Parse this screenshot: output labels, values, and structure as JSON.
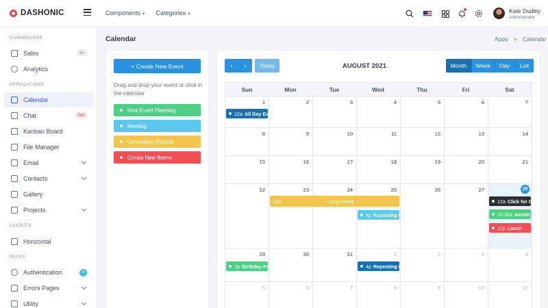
{
  "brand": {
    "name": "DASHONIC"
  },
  "topnav": [
    {
      "label": "Components"
    },
    {
      "label": "Categories"
    }
  ],
  "user": {
    "name": "Kate Dudley",
    "role": "Administrator"
  },
  "sidebar": {
    "sections": {
      "dashboards": "DASHBOARDS",
      "applications": "APPLICATIONS",
      "layouts": "LAYOUTS",
      "pages": "PAGES"
    },
    "items": [
      {
        "label": "Sales",
        "badge": "5+"
      },
      {
        "label": "Analytics"
      },
      {
        "label": "Calendar"
      },
      {
        "label": "Chat",
        "badge": "Hot"
      },
      {
        "label": "Kanban Board"
      },
      {
        "label": "File Manager"
      },
      {
        "label": "Email"
      },
      {
        "label": "Contacts"
      },
      {
        "label": "Gallery"
      },
      {
        "label": "Projects"
      },
      {
        "label": "Horizontal"
      },
      {
        "label": "Authentication",
        "badge": "9"
      },
      {
        "label": "Errors Pages"
      },
      {
        "label": "Utility"
      }
    ]
  },
  "page": {
    "title": "Calendar",
    "breadcrumb_root": "Apps",
    "breadcrumb_sep": ">",
    "breadcrumb_current": "Calendar"
  },
  "left_panel": {
    "create_label": "+ Create New Event",
    "drag_text": "Drag and drop your event or click in the calendar",
    "events": [
      {
        "label": "New Event Planning",
        "color": "#4fcf86"
      },
      {
        "label": "Meeting",
        "color": "#5bc8ec"
      },
      {
        "label": "Generating Reports",
        "color": "#f2c64e"
      },
      {
        "label": "Create New theme",
        "color": "#ef4f55"
      }
    ]
  },
  "calendar": {
    "prev_icon": "‹",
    "next_icon": "›",
    "today_label": "Today",
    "month_title": "AUGUST 2021",
    "views": [
      "Month",
      "Week",
      "Day",
      "List"
    ],
    "active_view": "Month",
    "weekdays": [
      "Sun",
      "Mon",
      "Tue",
      "Wed",
      "Thu",
      "Fri",
      "Sat"
    ],
    "weeks": [
      [
        "1",
        "2",
        "3",
        "4",
        "5",
        "6",
        "7"
      ],
      [
        "8",
        "9",
        "10",
        "11",
        "12",
        "13",
        "14"
      ],
      [
        "15",
        "16",
        "17",
        "18",
        "19",
        "20",
        "21"
      ],
      [
        "22",
        "23",
        "24",
        "25",
        "26",
        "27",
        "28"
      ],
      [
        "29",
        "30",
        "31",
        "1",
        "2",
        "3",
        "4"
      ],
      [
        "5",
        "6",
        "7",
        "8",
        "9",
        "10",
        "11"
      ]
    ],
    "today": "28",
    "events": {
      "all_day": {
        "time": "12a",
        "title": "All Day Ev",
        "color": "#1a6fb0"
      },
      "long_event": {
        "time": "12a",
        "title": "Long Event",
        "color": "#f2c64e"
      },
      "repeating_1": {
        "time": "4p",
        "title": "Repeating E",
        "color": "#5bc8ec"
      },
      "click_for": {
        "time": "12a",
        "title": "Click for G",
        "color": "#2b3035"
      },
      "meeting": {
        "time": "10:30a",
        "title": "Meetin",
        "color": "#4fcf86"
      },
      "lunch": {
        "time": "12p",
        "title": "Lunch",
        "color": "#ef4f55"
      },
      "birthday": {
        "time": "7p",
        "title": "Birthday Pa",
        "color": "#4fcf86"
      },
      "repeating_2": {
        "time": "4p",
        "title": "Repeating E",
        "color": "#1a6fb0"
      }
    }
  }
}
